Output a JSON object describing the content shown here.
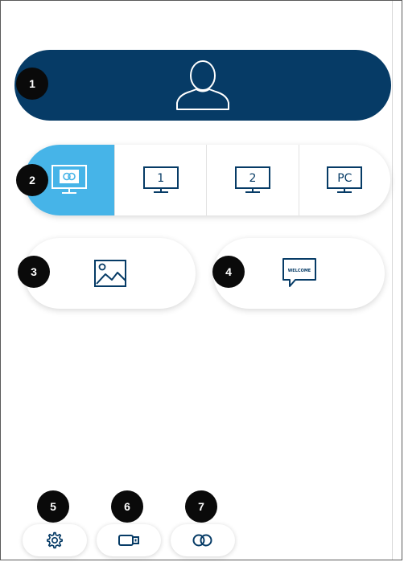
{
  "badges": [
    "1",
    "2",
    "3",
    "4",
    "5",
    "6",
    "7"
  ],
  "sources": [
    {
      "label": "",
      "icon": "airtame-monitor-icon",
      "active": true
    },
    {
      "label": "1",
      "icon": "monitor-1-icon",
      "active": false
    },
    {
      "label": "2",
      "icon": "monitor-2-icon",
      "active": false
    },
    {
      "label": "PC",
      "icon": "monitor-pc-icon",
      "active": false
    }
  ],
  "welcome_label": "WELCOME",
  "colors": {
    "navy": "#063b66",
    "accent": "#46b4e8",
    "badge": "#0a0a0a"
  }
}
